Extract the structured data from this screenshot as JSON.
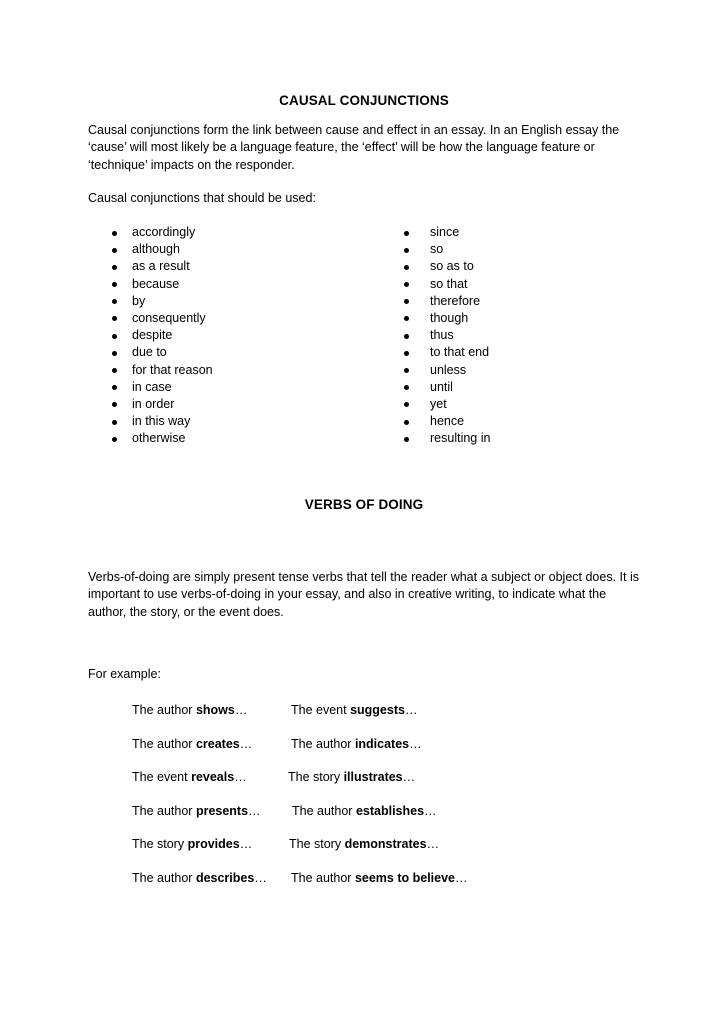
{
  "section1": {
    "title": "CAUSAL CONJUNCTIONS",
    "intro_lines": [
      "Causal conjunctions form the link between cause and effect in an essay. In an English essay the",
      "‘cause’ will most likely be a language feature, the ‘effect’ will be how the language feature or",
      "‘technique’ impacts on the responder."
    ],
    "list_intro": "Causal conjunctions that should be used:",
    "left_list": [
      "accordingly",
      "although",
      "as a result",
      "because",
      "by",
      "consequently",
      "despite",
      "due to",
      "for that reason",
      "in case",
      "in order",
      "in this way",
      "otherwise"
    ],
    "right_list": [
      "since",
      "so",
      "so as to",
      "so that",
      "therefore",
      "though",
      "thus",
      "to that end",
      "unless",
      "until",
      "yet",
      "hence",
      "resulting in"
    ]
  },
  "section2": {
    "title": "VERBS OF DOING",
    "intro_lines": [
      "Verbs-of-doing are simply present tense verbs that tell the reader what a subject or object does. It is",
      "important to use verbs-of-doing in your essay, and also in creative writing, to indicate what the",
      "author, the story, or the event does."
    ],
    "example_label": "For example:",
    "examples": [
      {
        "left": {
          "subject": "The author ",
          "verb": "shows",
          "ellipsis": "…"
        },
        "right": {
          "subject": "The event ",
          "verb": "suggests",
          "ellipsis": "…"
        }
      },
      {
        "left": {
          "subject": "The author ",
          "verb": "creates",
          "ellipsis": "…"
        },
        "right": {
          "subject": "The author ",
          "verb": "indicates",
          "ellipsis": "…"
        }
      },
      {
        "left": {
          "subject": "The event ",
          "verb": "reveals",
          "ellipsis": "…"
        },
        "right": {
          "subject": "The story ",
          "verb": "illustrates",
          "ellipsis": "…"
        }
      },
      {
        "left": {
          "subject": "The author ",
          "verb": "presents",
          "ellipsis": "…"
        },
        "right": {
          "subject": "The author ",
          "verb": "establishes",
          "ellipsis": "…"
        }
      },
      {
        "left": {
          "subject": "The story ",
          "verb": "provides",
          "ellipsis": "…"
        },
        "right": {
          "subject": "The story ",
          "verb": "demonstrates",
          "ellipsis": "…"
        }
      },
      {
        "left": {
          "subject": "The author ",
          "verb": "describes",
          "ellipsis": "…"
        },
        "right": {
          "subject": "The author ",
          "verb": "seems to believe",
          "ellipsis": "…"
        }
      }
    ]
  }
}
